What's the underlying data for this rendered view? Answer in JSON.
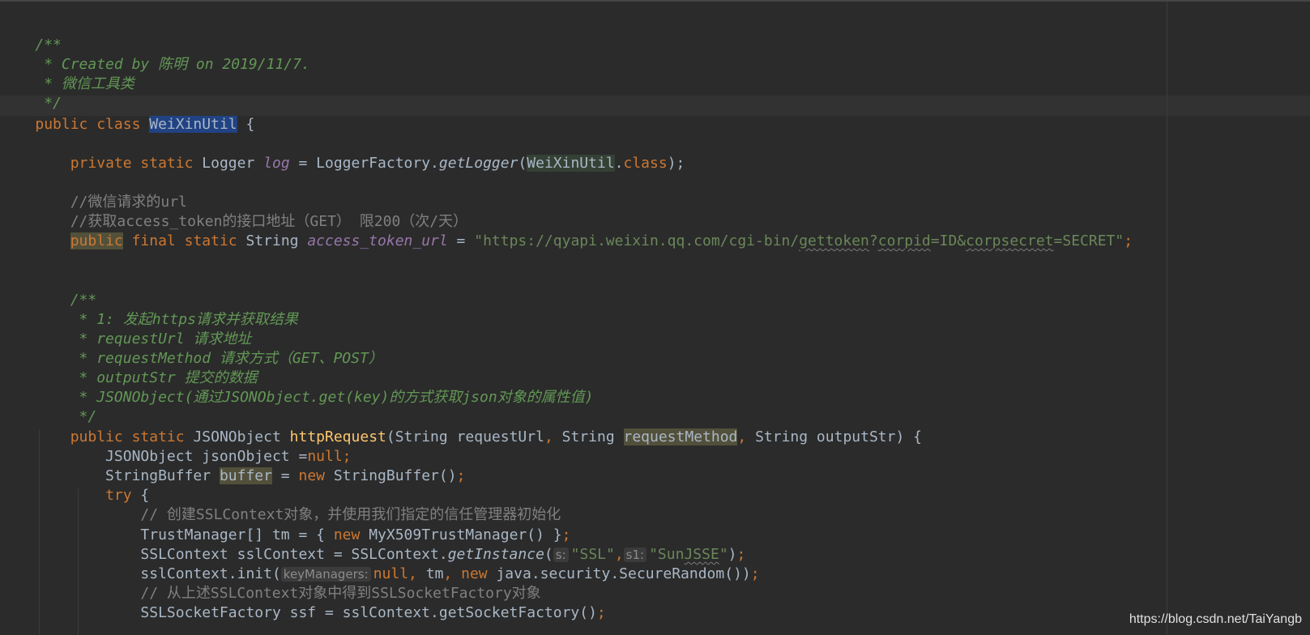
{
  "lines": {
    "l1": {
      "t1": "/**"
    },
    "l2": {
      "t1": " * Created by 陈明 on 2019/11/7."
    },
    "l3": {
      "t1": " * 微信工具类"
    },
    "l4": {
      "t1": " */"
    },
    "l5": {
      "t1": "public class ",
      "t2": "WeiXinUtil",
      "t3": " {"
    },
    "l6": {
      "t1": "    ",
      "t2": "private static ",
      "t3": "Logger ",
      "t4": "log",
      "t5": " = LoggerFactory.",
      "t6": "getLogger",
      "t7": "(",
      "t8": "WeiXinUtil",
      "t9": ".",
      "t10": "class",
      "t11": ");"
    },
    "l7": {
      "t1": "    //微信请求的url"
    },
    "l8": {
      "t1": "    //获取access_token的接口地址（GET） 限200（次/天）"
    },
    "l9": {
      "t1": "    ",
      "t2": "public",
      "t3": " final static ",
      "t4": "String ",
      "t5": "access_token_url",
      "t6": " = ",
      "t7": "\"https://qyapi.weixin.qq.com/cgi-bin/",
      "t8": "gettoken",
      "t9": "?",
      "t10": "corpid",
      "t11": "=ID&",
      "t12": "corpsecret",
      "t13": "=SECRET\"",
      "t14": ";"
    },
    "l10": {
      "t1": "    /**"
    },
    "l11": {
      "t1": "     * 1: 发起https请求并获取结果"
    },
    "l12": {
      "t1": "     * requestUrl 请求地址"
    },
    "l13": {
      "t1": "     * requestMethod 请求方式（GET、POST）"
    },
    "l14": {
      "t1": "     * outputStr 提交的数据"
    },
    "l15": {
      "t1": "     * JSONObject(通过JSONObject.get(key)的方式获取json对象的属性值)"
    },
    "l16": {
      "t1": "     */"
    },
    "l17": {
      "t1": "    ",
      "t2": "public static ",
      "t3": "JSONObject ",
      "t4": "httpRequest",
      "t5": "(String requestUrl",
      "t6": ", ",
      "t7": "String ",
      "t8": "requestMethod",
      "t9": ", ",
      "t10": "String outputStr) {"
    },
    "l18": {
      "t1": "        JSONObject jsonObject =",
      "t2": "null",
      "t3": ";"
    },
    "l19": {
      "t1": "        StringBuffer ",
      "t2": "buffer",
      "t3": " = ",
      "t4": "new ",
      "t5": "StringBuffer()",
      "t6": ";"
    },
    "l20": {
      "t1": "        ",
      "t2": "try",
      "t3": " {"
    },
    "l21": {
      "t1": "            // 创建SSLContext对象，并使用我们指定的信任管理器初始化"
    },
    "l22": {
      "t1": "            TrustManager[] tm = { ",
      "t2": "new ",
      "t3": "MyX509TrustManager() }",
      "t4": ";"
    },
    "l23": {
      "t1": "            SSLContext sslContext = SSLContext.",
      "t2": "getInstance",
      "t3": "(",
      "h1": "s:",
      "t4": "\"SSL\"",
      "t5": ",",
      "h2": "s1:",
      "t6": "\"Sun",
      "t7": "JSSE",
      "t8": "\"",
      "t9": ")",
      "t10": ";"
    },
    "l24": {
      "t1": "            sslContext.init(",
      "h1": "keyManagers:",
      "t2": "null",
      "t3": ", ",
      "t4": "tm",
      "t5": ", ",
      "t6": "new ",
      "t7": "java.security.SecureRandom())",
      "t8": ";"
    },
    "l25": {
      "t1": "            // 从上述SSLContext对象中得到SSLSocketFactory对象"
    },
    "l26": {
      "t1": "            SSLSocketFactory ssf = sslContext.getSocketFactory()",
      "t2": ";"
    }
  },
  "watermark": "https://blog.csdn.net/TaiYangb",
  "colors": {
    "background": "#2b2b2b",
    "keyword": "#cc7832",
    "doc_comment": "#629755",
    "comment": "#808080",
    "string": "#6a8759",
    "field": "#9876aa",
    "method": "#ffc66d",
    "text": "#a9b7c6",
    "selection": "#214283"
  }
}
